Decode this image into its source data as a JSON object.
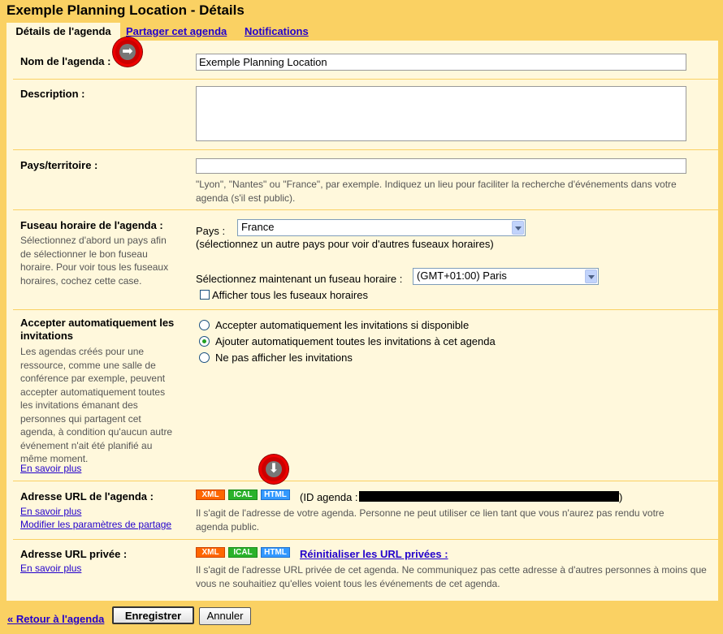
{
  "window": {
    "title": "Exemple Planning Location - Détails"
  },
  "tabs": [
    {
      "label": "Détails de l'agenda"
    },
    {
      "label": "Partager cet agenda"
    },
    {
      "label": "Notifications"
    }
  ],
  "name_section": {
    "label": "Nom de l'agenda :",
    "value": "Exemple Planning Location"
  },
  "description_section": {
    "label": "Description :",
    "value": ""
  },
  "country_section": {
    "label": "Pays/territoire :",
    "value": "",
    "hint": "\"Lyon\", \"Nantes\" ou \"France\", par exemple. Indiquez un lieu pour faciliter la recherche d'événements dans votre agenda (s'il est public)."
  },
  "timezone_section": {
    "label": "Fuseau horaire de l'agenda :",
    "help": "Sélectionnez d'abord un pays afin de sélectionner le bon fuseau horaire. Pour voir tous les fuseaux horaires, cochez cette case.",
    "country_label": "Pays :",
    "country_value": "France",
    "country_hint": "(sélectionnez un autre pays pour voir d'autres fuseaux horaires)",
    "tz_label": "Sélectionnez maintenant un fuseau horaire :",
    "tz_value": "(GMT+01:00) Paris",
    "show_all_label": "Afficher tous les fuseaux horaires"
  },
  "invites_section": {
    "label": "Accepter automatiquement les invitations",
    "help": "Les agendas créés pour une ressource, comme une salle de conférence par exemple, peuvent accepter automatiquement toutes les invitations émanant des personnes qui partagent cet agenda, à condition qu'aucun autre événement n'ait été planifié au même moment.",
    "learn_more": "En savoir plus",
    "options": [
      {
        "label": "Accepter automatiquement les invitations si disponible"
      },
      {
        "label": "Ajouter automatiquement toutes les invitations à cet agenda"
      },
      {
        "label": "Ne pas afficher les invitations"
      }
    ]
  },
  "url_section": {
    "label": "Adresse URL de l'agenda :",
    "learn_more": "En savoir plus",
    "modify_link": "Modifier les paramètres de partage",
    "badges": [
      "XML",
      "ICAL",
      "HTML"
    ],
    "id_prefix": "(ID agenda :",
    "id_suffix": ")",
    "hint": "Il s'agit de l'adresse de votre agenda. Personne ne peut utiliser ce lien tant que vous n'aurez pas rendu votre agenda public."
  },
  "private_section": {
    "label": "Adresse URL privée :",
    "learn_more": "En savoir plus",
    "badges": [
      "XML",
      "ICAL",
      "HTML"
    ],
    "reset_link": "Réinitialiser les URL privées :",
    "hint": "Il s'agit de l'adresse URL privée de cet agenda. Ne communiquez pas cette adresse à d'autres personnes à moins que vous ne souhaitiez qu'elles voient tous les événements de cet agenda."
  },
  "footer": {
    "back_link": "« Retour à l'agenda",
    "save": "Enregistrer",
    "cancel": "Annuler"
  }
}
